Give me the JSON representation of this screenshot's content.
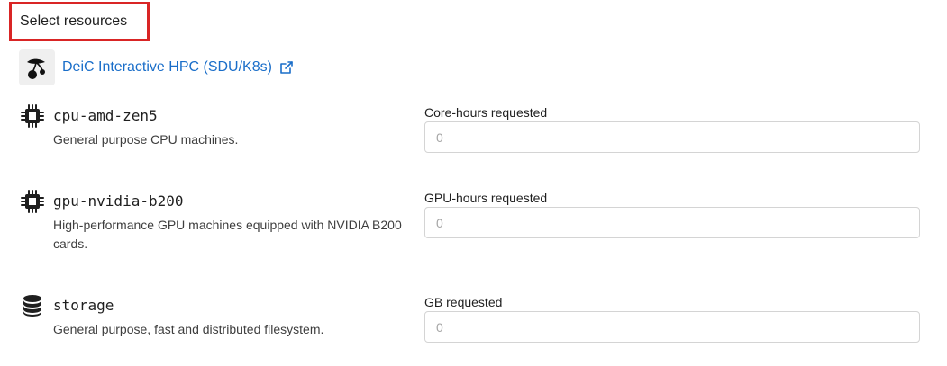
{
  "section": {
    "title": "Select resources"
  },
  "provider": {
    "name": "DeiC Interactive HPC (SDU/K8s)",
    "logo_icon": "cherry-logo-icon",
    "link_icon": "external-link-icon",
    "link_color": "#1a6ec9"
  },
  "resources": [
    {
      "icon": "cpu-chip-icon",
      "name": "cpu-amd-zen5",
      "description": "General purpose CPU machines.",
      "field_label": "Core-hours requested",
      "placeholder": "0"
    },
    {
      "icon": "gpu-chip-icon",
      "name": "gpu-nvidia-b200",
      "description": "High-performance GPU machines equipped with NVIDIA B200 cards.",
      "field_label": "GPU-hours requested",
      "placeholder": "0"
    },
    {
      "icon": "database-icon",
      "name": "storage",
      "description": "General purpose, fast and distributed filesystem.",
      "field_label": "GB requested",
      "placeholder": "0"
    }
  ]
}
